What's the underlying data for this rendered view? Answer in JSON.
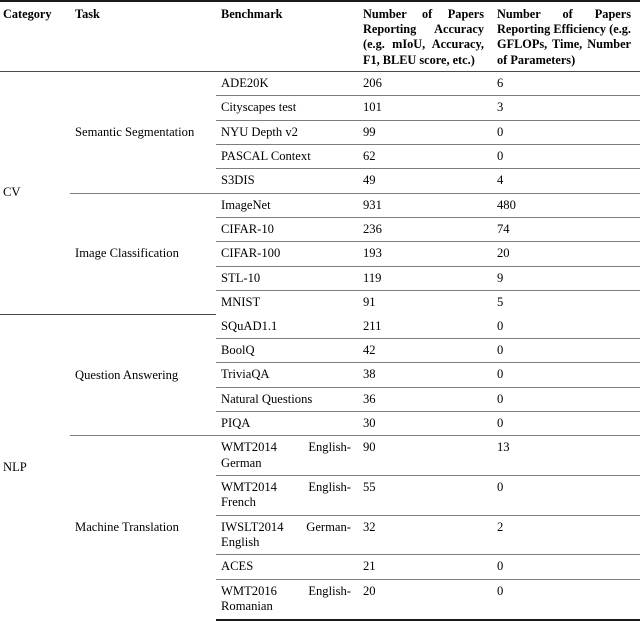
{
  "table": {
    "headers": {
      "category": "Category",
      "task": "Task",
      "benchmark": "Benchmark",
      "accuracy": "Number of Papers Reporting Accuracy (e.g. mIoU, Accuracy, F1, BLEU score, etc.)",
      "efficiency": "Number of Papers Reporting Efficiency (e.g. GFLOPs, Time, Number of Parameters)"
    },
    "rows": [
      {
        "category": "CV",
        "task": "Semantic Segmentation",
        "benchmark": "ADE20K",
        "accuracy": "206",
        "efficiency": "6"
      },
      {
        "category": "CV",
        "task": "Semantic Segmentation",
        "benchmark": "Cityscapes test",
        "accuracy": "101",
        "efficiency": "3"
      },
      {
        "category": "CV",
        "task": "Semantic Segmentation",
        "benchmark": "NYU Depth v2",
        "accuracy": "99",
        "efficiency": "0"
      },
      {
        "category": "CV",
        "task": "Semantic Segmentation",
        "benchmark": "PASCAL Context",
        "accuracy": "62",
        "efficiency": "0"
      },
      {
        "category": "CV",
        "task": "Semantic Segmentation",
        "benchmark": "S3DIS",
        "accuracy": "49",
        "efficiency": "4"
      },
      {
        "category": "CV",
        "task": "Image Classification",
        "benchmark": "ImageNet",
        "accuracy": "931",
        "efficiency": "480"
      },
      {
        "category": "CV",
        "task": "Image Classification",
        "benchmark": "CIFAR-10",
        "accuracy": "236",
        "efficiency": "74"
      },
      {
        "category": "CV",
        "task": "Image Classification",
        "benchmark": "CIFAR-100",
        "accuracy": "193",
        "efficiency": "20"
      },
      {
        "category": "CV",
        "task": "Image Classification",
        "benchmark": "STL-10",
        "accuracy": "119",
        "efficiency": "9"
      },
      {
        "category": "CV",
        "task": "Image Classification",
        "benchmark": "MNIST",
        "accuracy": "91",
        "efficiency": "5"
      },
      {
        "category": "NLP",
        "task": "Question Answering",
        "benchmark": "SQuAD1.1",
        "accuracy": "211",
        "efficiency": "0"
      },
      {
        "category": "NLP",
        "task": "Question Answering",
        "benchmark": "BoolQ",
        "accuracy": "42",
        "efficiency": "0"
      },
      {
        "category": "NLP",
        "task": "Question Answering",
        "benchmark": "TriviaQA",
        "accuracy": "38",
        "efficiency": "0"
      },
      {
        "category": "NLP",
        "task": "Question Answering",
        "benchmark": "Natural Questions",
        "accuracy": "36",
        "efficiency": "0"
      },
      {
        "category": "NLP",
        "task": "Question Answering",
        "benchmark": "PIQA",
        "accuracy": "30",
        "efficiency": "0"
      },
      {
        "category": "NLP",
        "task": "Machine Translation",
        "benchmark": "WMT2014 English-German",
        "accuracy": "90",
        "efficiency": "13"
      },
      {
        "category": "NLP",
        "task": "Machine Translation",
        "benchmark": "WMT2014 English-French",
        "accuracy": "55",
        "efficiency": "0"
      },
      {
        "category": "NLP",
        "task": "Machine Translation",
        "benchmark": "IWSLT2014 German-English",
        "accuracy": "32",
        "efficiency": "2"
      },
      {
        "category": "NLP",
        "task": "Machine Translation",
        "benchmark": "ACES",
        "accuracy": "21",
        "efficiency": "0"
      },
      {
        "category": "NLP",
        "task": "Machine Translation",
        "benchmark": "WMT2016 English-Romanian",
        "accuracy": "20",
        "efficiency": "0"
      }
    ],
    "category_groups": [
      {
        "label": "CV",
        "task_groups": [
          {
            "label": "Semantic Segmentation",
            "count": 5
          },
          {
            "label": "Image Classification",
            "count": 5
          }
        ]
      },
      {
        "label": "NLP",
        "task_groups": [
          {
            "label": "Question Answering",
            "count": 5
          },
          {
            "label": "Machine Translation",
            "count": 5
          }
        ]
      }
    ]
  }
}
